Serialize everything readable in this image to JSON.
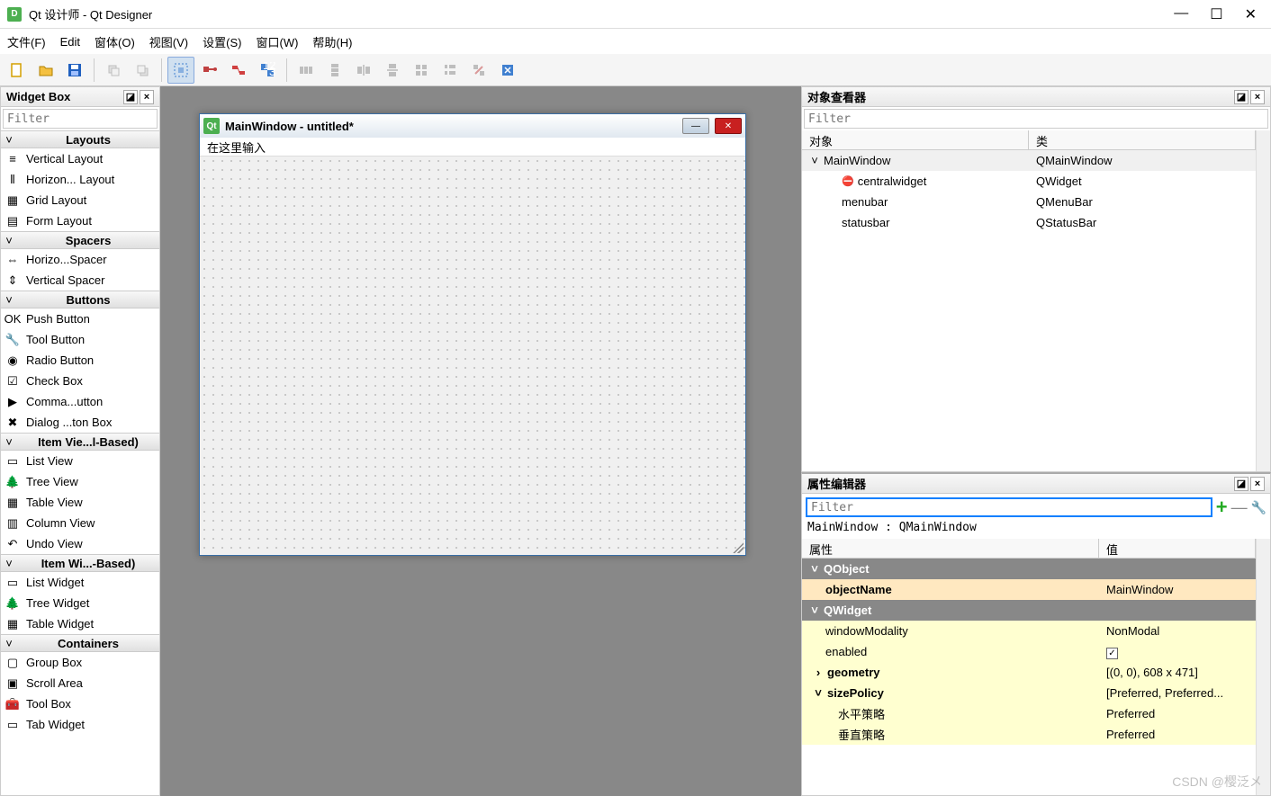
{
  "app": {
    "title": "Qt 设计师 - Qt Designer",
    "icon_letter": "D"
  },
  "menus": {
    "file": "文件(F)",
    "edit": "Edit",
    "form": "窗体(O)",
    "view": "视图(V)",
    "settings": "设置(S)",
    "window": "窗口(W)",
    "help": "帮助(H)"
  },
  "widgetbox": {
    "title": "Widget Box",
    "filter_placeholder": "Filter",
    "groups": [
      {
        "name": "Layouts",
        "items": [
          "Vertical Layout",
          "Horizon... Layout",
          "Grid Layout",
          "Form Layout"
        ]
      },
      {
        "name": "Spacers",
        "items": [
          "Horizo...Spacer",
          "Vertical Spacer"
        ]
      },
      {
        "name": "Buttons",
        "items": [
          "Push Button",
          "Tool Button",
          "Radio Button",
          "Check Box",
          "Comma...utton",
          "Dialog ...ton Box"
        ]
      },
      {
        "name": "Item Vie...l-Based)",
        "items": [
          "List View",
          "Tree View",
          "Table View",
          "Column View",
          "Undo View"
        ]
      },
      {
        "name": "Item Wi...-Based)",
        "items": [
          "List Widget",
          "Tree Widget",
          "Table Widget"
        ]
      },
      {
        "name": "Containers",
        "items": [
          "Group Box",
          "Scroll Area",
          "Tool Box",
          "Tab Widget"
        ]
      }
    ]
  },
  "form": {
    "title": "MainWindow - untitled*",
    "menu_placeholder": "在这里输入"
  },
  "inspector": {
    "title": "对象查看器",
    "filter_placeholder": "Filter",
    "cols": {
      "object": "对象",
      "class": "类"
    },
    "rows": [
      {
        "indent": 8,
        "chev": "˅",
        "name": "MainWindow",
        "class": "QMainWindow",
        "sel": true
      },
      {
        "indent": 44,
        "name": "centralwidget",
        "class": "QWidget",
        "icon": "⛔"
      },
      {
        "indent": 44,
        "name": "menubar",
        "class": "QMenuBar"
      },
      {
        "indent": 44,
        "name": "statusbar",
        "class": "QStatusBar"
      }
    ]
  },
  "propeditor": {
    "title": "属性编辑器",
    "filter_placeholder": "Filter",
    "caption": "MainWindow : QMainWindow",
    "cols": {
      "prop": "属性",
      "value": "值"
    },
    "rows": [
      {
        "type": "group",
        "name": "QObject"
      },
      {
        "type": "orange",
        "indent": 26,
        "name": "objectName",
        "value": "MainWindow",
        "bold": true
      },
      {
        "type": "group",
        "name": "QWidget"
      },
      {
        "type": "yellow",
        "indent": 26,
        "name": "windowModality",
        "value": "NonModal"
      },
      {
        "type": "yellow",
        "indent": 26,
        "name": "enabled",
        "value_checkbox": true
      },
      {
        "type": "yellow",
        "indent": 12,
        "chev": "›",
        "name": "geometry",
        "value": "[(0, 0), 608 x 471]",
        "bold": true
      },
      {
        "type": "yellow",
        "indent": 12,
        "chev": "˅",
        "name": "sizePolicy",
        "value": "[Preferred, Preferred...",
        "bold": true
      },
      {
        "type": "yellow",
        "indent": 40,
        "name": "水平策略",
        "value": "Preferred"
      },
      {
        "type": "yellow",
        "indent": 40,
        "name": "垂直策略",
        "value": "Preferred"
      }
    ]
  },
  "watermark": "CSDN @樱泛メ"
}
